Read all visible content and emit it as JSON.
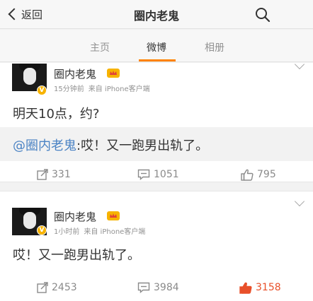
{
  "navbar": {
    "back_label": "返回",
    "title": "圈内老鬼"
  },
  "tabs": [
    {
      "label": "主页"
    },
    {
      "label": "微博",
      "active": true
    },
    {
      "label": "相册"
    }
  ],
  "posts": [
    {
      "username": "圈内老鬼",
      "time": "15分钟前",
      "source": "来自 iPhone客户端",
      "text": "明天10点，约?",
      "repost": {
        "mention": "@圈内老鬼",
        "text": ":哎！又一跑男出轨了。"
      },
      "reposts": "331",
      "comments": "1051",
      "likes": "795",
      "liked": false
    },
    {
      "username": "圈内老鬼",
      "time": "1小时前",
      "source": "来自 iPhone客户端",
      "text": "哎！又一跑男出轨了。",
      "reposts": "2453",
      "comments": "3984",
      "likes": "3158",
      "liked": true
    }
  ],
  "colors": {
    "accent": "#ff8200",
    "link": "#4b83c4",
    "liked": "#e8502a",
    "badge": "#f7b300"
  },
  "icons": {
    "back": "chevron-left-icon",
    "search": "search-icon",
    "repost": "repost-icon",
    "comment": "comment-icon",
    "like": "thumbs-up-icon",
    "verified": "verified-v-icon",
    "member": "member-crown-icon",
    "more": "chevron-down-icon"
  }
}
